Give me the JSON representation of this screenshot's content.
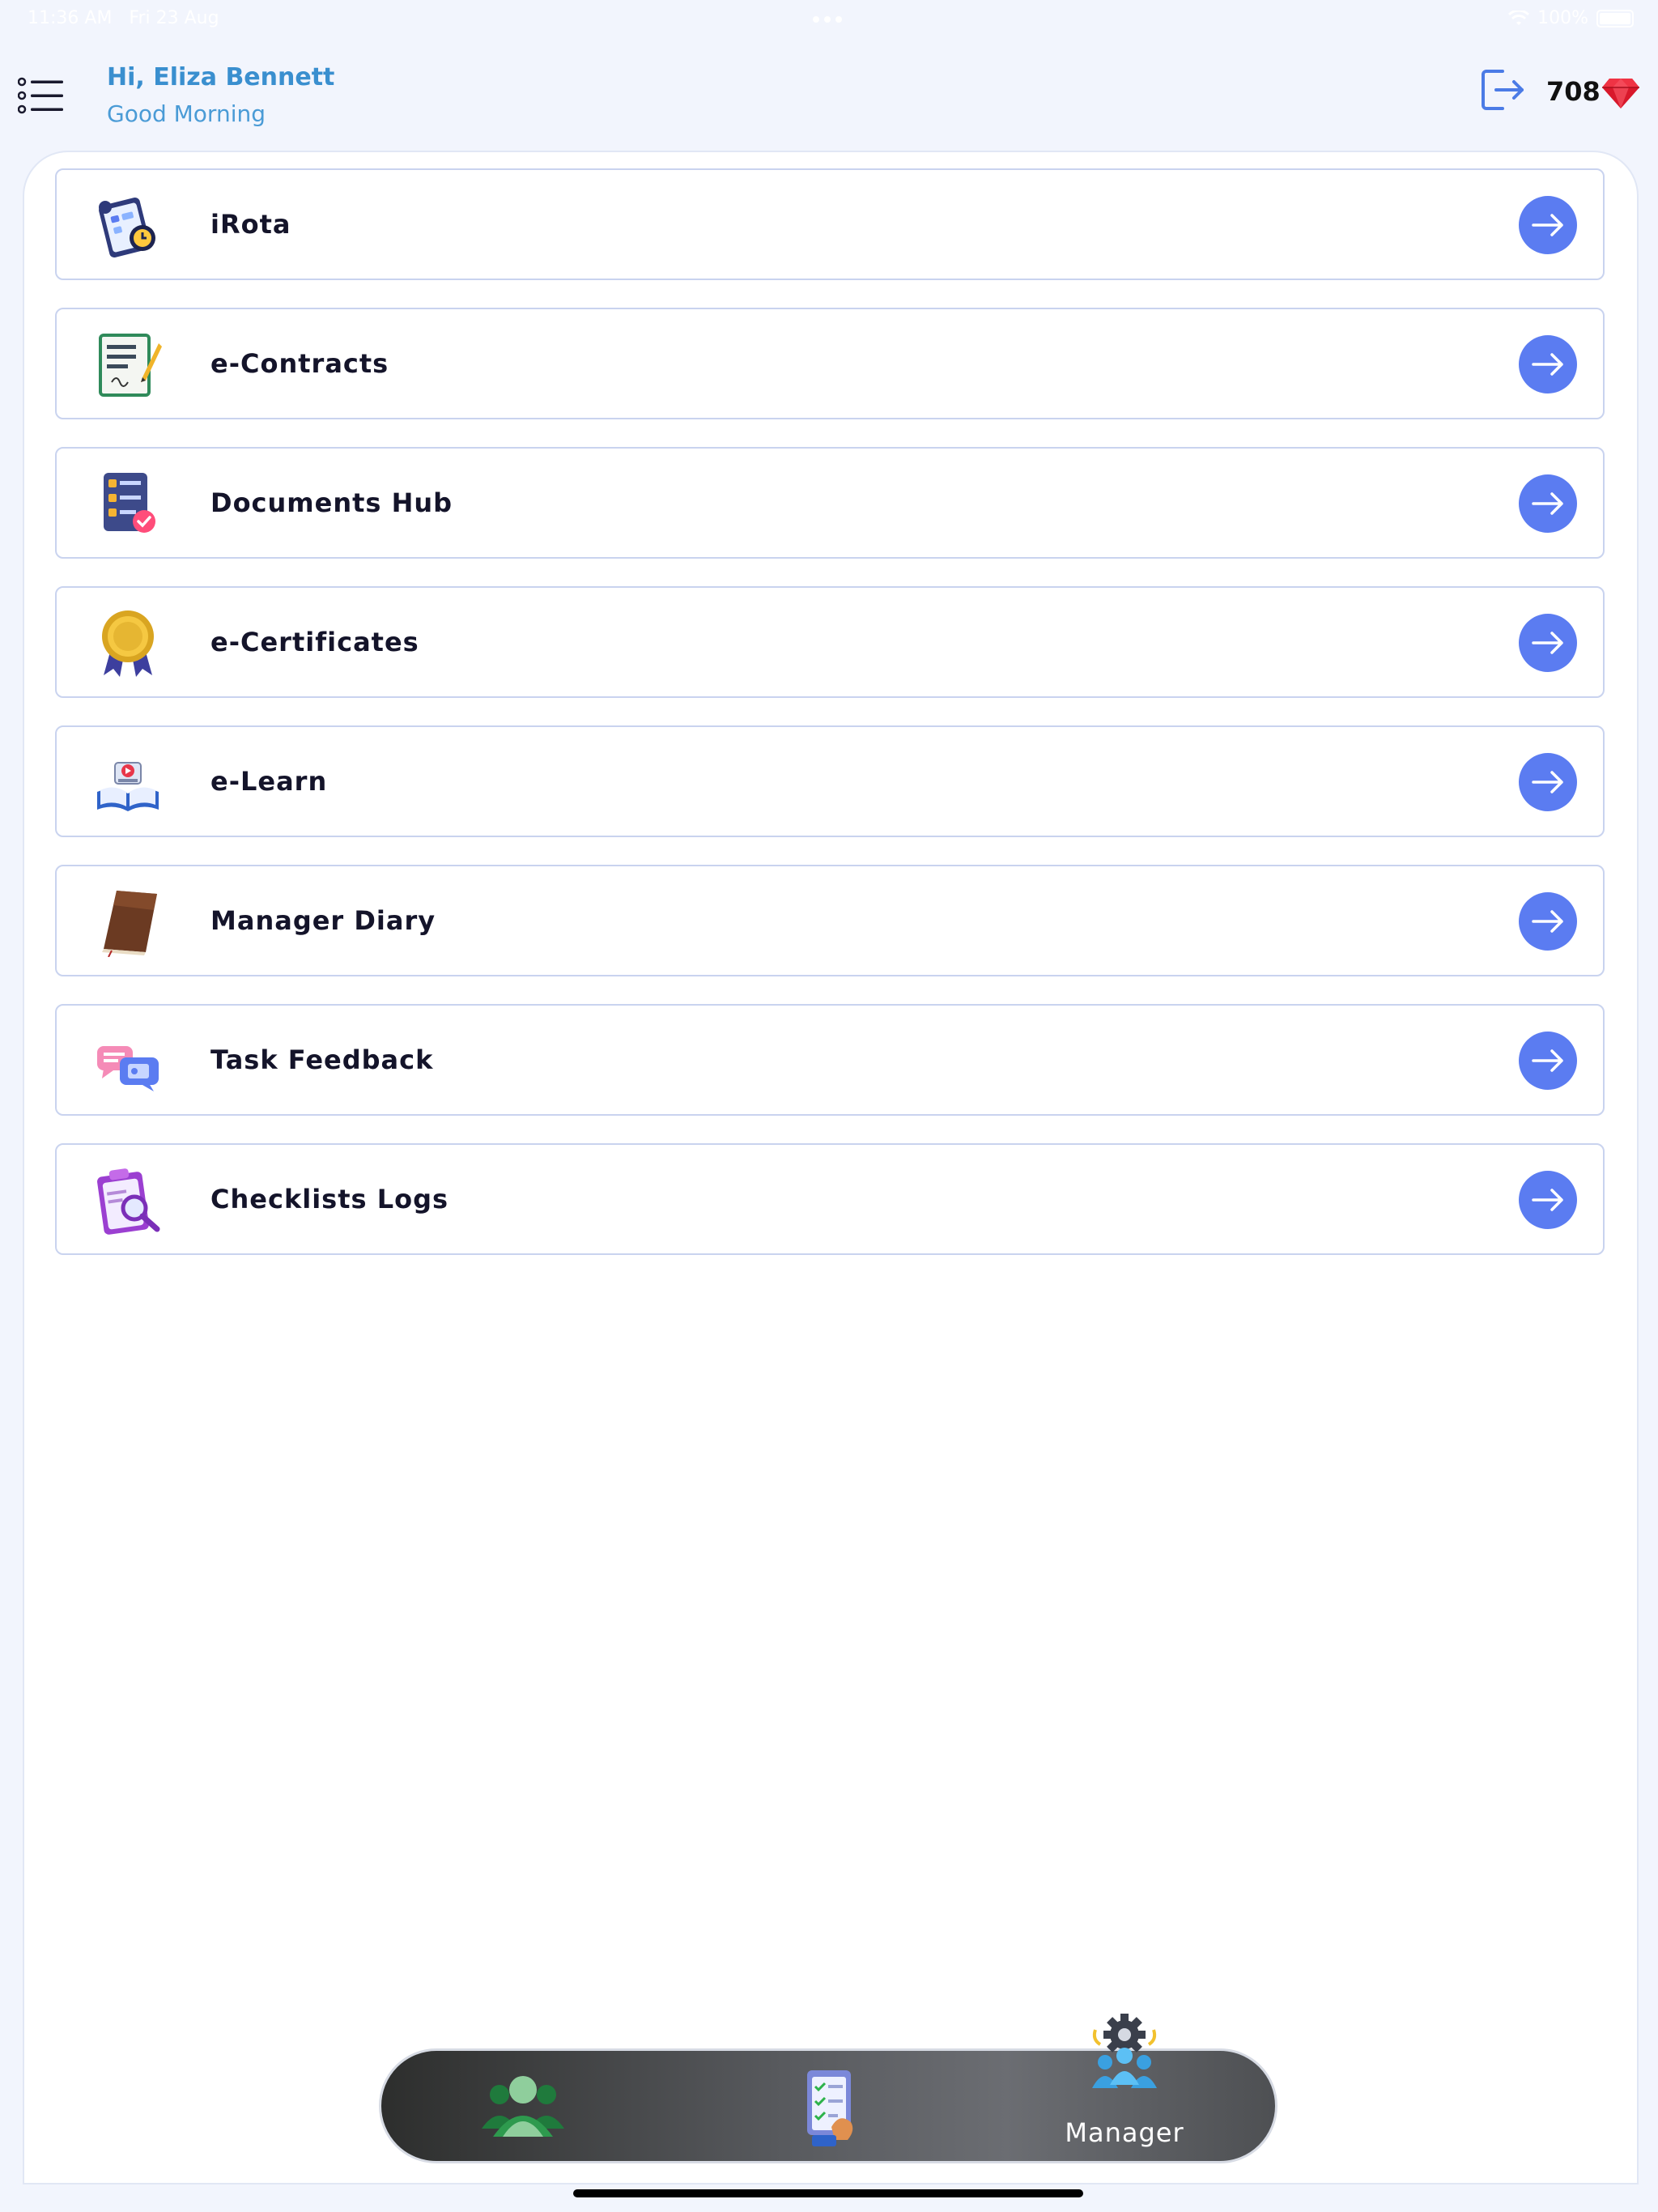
{
  "status_bar": {
    "time": "11:36 AM",
    "date": "Fri 23 Aug",
    "battery": "100%"
  },
  "header": {
    "greeting": "Hi, Eliza Bennett",
    "subtitle": "Good Morning",
    "points": "708",
    "menu_icon": "list-icon",
    "logout_icon": "logout-icon",
    "gem_icon": "ruby-gem-icon"
  },
  "menu": {
    "items": [
      {
        "label": "iRota",
        "icon": "rota-clipboard-icon"
      },
      {
        "label": "e-Contracts",
        "icon": "contract-document-icon"
      },
      {
        "label": "Documents Hub",
        "icon": "documents-checklist-icon"
      },
      {
        "label": "e-Certificates",
        "icon": "award-ribbon-icon"
      },
      {
        "label": "e-Learn",
        "icon": "open-book-video-icon"
      },
      {
        "label": "Manager Diary",
        "icon": "diary-book-icon"
      },
      {
        "label": "Task Feedback",
        "icon": "feedback-chat-icon"
      },
      {
        "label": "Checklists Logs",
        "icon": "clipboard-magnifier-icon"
      }
    ]
  },
  "tab_bar": {
    "tabs": [
      {
        "icon": "users-group-icon"
      },
      {
        "icon": "checklist-hand-icon"
      },
      {
        "icon": "manager-gear-team-icon",
        "label": "Manager"
      }
    ]
  },
  "colors": {
    "accent": "#5b7cf1",
    "greeting": "#3a8fcf",
    "background": "#f2f5fd"
  }
}
